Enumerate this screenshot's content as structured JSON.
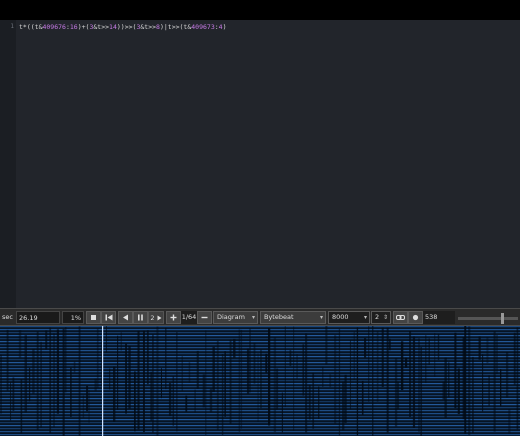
{
  "editor": {
    "line_number": "1",
    "code_segments": [
      {
        "text": "t*((t&",
        "kind": "op"
      },
      {
        "text": "409676",
        "kind": "num"
      },
      {
        "text": ":",
        "kind": "op"
      },
      {
        "text": "16",
        "kind": "num"
      },
      {
        "text": ")+(",
        "kind": "op"
      },
      {
        "text": "3",
        "kind": "num"
      },
      {
        "text": "&t>>",
        "kind": "op"
      },
      {
        "text": "14",
        "kind": "num"
      },
      {
        "text": "))>>(",
        "kind": "op"
      },
      {
        "text": "3",
        "kind": "num"
      },
      {
        "text": "&t>>",
        "kind": "op"
      },
      {
        "text": "8",
        "kind": "num"
      },
      {
        "text": ")|t>>(t&",
        "kind": "op"
      },
      {
        "text": "409673",
        "kind": "num"
      },
      {
        "text": ":",
        "kind": "op"
      },
      {
        "text": "4",
        "kind": "num"
      },
      {
        "text": ")",
        "kind": "op"
      }
    ]
  },
  "toolbar": {
    "sec_label": "sec",
    "time_value": "26.19",
    "volume_value": "1%",
    "stop_icon": "stop-icon",
    "restart_icon": "restart-icon",
    "rewind_icon": "rewind-icon",
    "pause_icon": "pause-icon",
    "speed_value": "2",
    "forward_icon": "fast-forward-icon",
    "plus_icon": "plus-icon",
    "scale_value": "1/64",
    "minus_icon": "minus-icon",
    "draw_mode": "Diagram",
    "audio_mode": "Bytebeat",
    "sample_rate": "8000",
    "divisor": "2",
    "link_icon": "link-icon",
    "record_icon": "record-icon",
    "counter_value": "538"
  },
  "colors": {
    "editor_bg": "#22252b",
    "number": "#c77be6",
    "waveform_bg": "#061425",
    "waveform_fg": "#2f73c6"
  }
}
